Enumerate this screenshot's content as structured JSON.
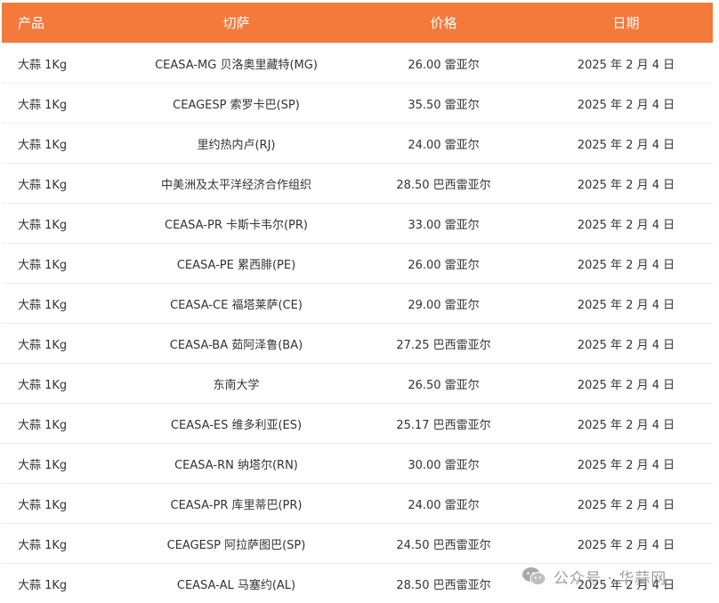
{
  "table": {
    "headers": {
      "product": "产品",
      "market": "切萨",
      "price": "价格",
      "date": "日期"
    },
    "rows": [
      {
        "product": "大蒜 1Kg",
        "market": "CEASA-MG 贝洛奥里藏特(MG)",
        "price": "26.00 雷亚尔",
        "date": "2025 年 2 月 4 日"
      },
      {
        "product": "大蒜 1Kg",
        "market": "CEAGESP 索罗卡巴(SP)",
        "price": "35.50 雷亚尔",
        "date": "2025 年 2 月 4 日"
      },
      {
        "product": "大蒜 1Kg",
        "market": "里约热内卢(RJ)",
        "price": "24.00 雷亚尔",
        "date": "2025 年 2 月 4 日"
      },
      {
        "product": "大蒜 1Kg",
        "market": "中美洲及太平洋经济合作组织",
        "price": "28.50 巴西雷亚尔",
        "date": "2025 年 2 月 4 日"
      },
      {
        "product": "大蒜 1Kg",
        "market": "CEASA-PR 卡斯卡韦尔(PR)",
        "price": "33.00 雷亚尔",
        "date": "2025 年 2 月 4 日"
      },
      {
        "product": "大蒜 1Kg",
        "market": "CEASA-PE 累西腓(PE)",
        "price": "26.00 雷亚尔",
        "date": "2025 年 2 月 4 日"
      },
      {
        "product": "大蒜 1Kg",
        "market": "CEASA-CE 福塔莱萨(CE)",
        "price": "29.00 雷亚尔",
        "date": "2025 年 2 月 4 日"
      },
      {
        "product": "大蒜 1Kg",
        "market": "CEASA-BA 茹阿泽鲁(BA)",
        "price": "27.25 巴西雷亚尔",
        "date": "2025 年 2 月 4 日"
      },
      {
        "product": "大蒜 1Kg",
        "market": "东南大学",
        "price": "26.50 雷亚尔",
        "date": "2025 年 2 月 4 日"
      },
      {
        "product": "大蒜 1Kg",
        "market": "CEASA-ES 维多利亚(ES)",
        "price": "25.17 巴西雷亚尔",
        "date": "2025 年 2 月 4 日"
      },
      {
        "product": "大蒜 1Kg",
        "market": "CEASA-RN 纳塔尔(RN)",
        "price": "30.00 雷亚尔",
        "date": "2025 年 2 月 4 日"
      },
      {
        "product": "大蒜 1Kg",
        "market": "CEASA-PR 库里蒂巴(PR)",
        "price": "24.00 雷亚尔",
        "date": "2025 年 2 月 4 日"
      },
      {
        "product": "大蒜 1Kg",
        "market": "CEAGESP 阿拉萨图巴(SP)",
        "price": "24.50 巴西雷亚尔",
        "date": "2025 年 2 月 4 日"
      },
      {
        "product": "大蒜 1Kg",
        "market": "CEASA-AL 马塞约(AL)",
        "price": "28.50 巴西雷亚尔",
        "date": "2025 年 2 月 4 日"
      }
    ]
  },
  "watermark": {
    "icon": "wechat-icon",
    "text": "公众号 · 华蒜网"
  },
  "colors": {
    "header_bg": "#f47a3b",
    "header_text": "#ffffff",
    "body_text": "#333333",
    "row_border": "#eeeeee"
  }
}
